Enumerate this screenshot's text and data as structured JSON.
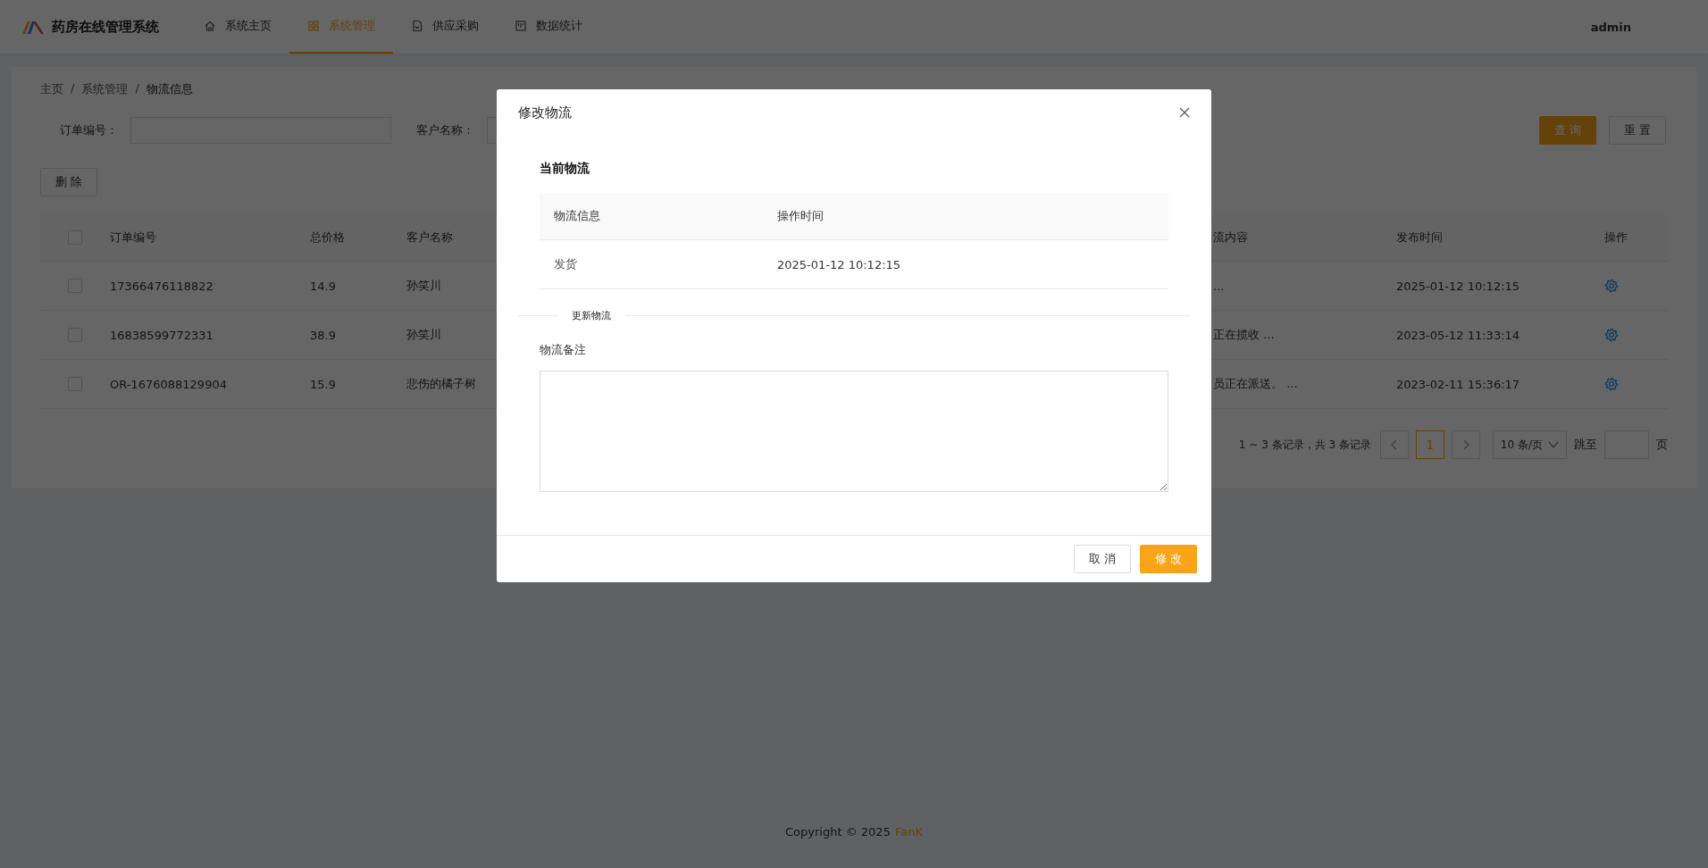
{
  "header": {
    "logo_text": "药房在线管理系统",
    "user": "admin",
    "nav": [
      {
        "label": "系统主页",
        "kind": "home",
        "selected": false
      },
      {
        "label": "系统管理",
        "kind": "grid",
        "selected": true
      },
      {
        "label": "供应采购",
        "kind": "doc",
        "selected": false
      },
      {
        "label": "数据统计",
        "kind": "board",
        "selected": false
      }
    ]
  },
  "breadcrumb": {
    "separator": "/",
    "items": [
      "主页",
      "系统管理",
      "物流信息"
    ]
  },
  "filters": [
    {
      "label": "订单编号："
    },
    {
      "label": "客户名称："
    }
  ],
  "filter_buttons": [
    {
      "label": "查 询",
      "primary": true
    },
    {
      "label": "重 置",
      "primary": false
    }
  ],
  "delete_button": "删 除",
  "table": {
    "all_checked": false,
    "columns": [
      "订单编号",
      "总价格",
      "客户名称",
      "流内容",
      "发布时间",
      "操作"
    ],
    "rows": [
      {
        "checked": false,
        "cells": [
          "17366476118822",
          "14.9",
          "孙笑川",
          "...",
          "2025-01-12 10:12:15"
        ]
      },
      {
        "checked": false,
        "cells": [
          "16838599772331",
          "38.9",
          "孙笑川",
          "正在揽收 ...",
          "2023-05-12 11:33:14"
        ]
      },
      {
        "checked": false,
        "cells": [
          "OR-1676088129904",
          "15.9",
          "悲伤的橘子树",
          "员正在派送。 ...",
          "2023-02-11 15:36:17"
        ]
      }
    ]
  },
  "pagination": {
    "summary": "1 ~ 3 条记录，共 3 条记录",
    "pages": [
      {
        "label": "1",
        "selected": true
      }
    ],
    "page_size": "10 条/页",
    "goto_label": "跳至",
    "page_suffix": "页"
  },
  "footer": {
    "text": "Copyright © 2025",
    "author": "FanK"
  },
  "modal": {
    "title": "修改物流",
    "section_title": "当前物流",
    "columns": [
      "物流信息",
      "操作时间"
    ],
    "rows": [
      [
        "发货",
        "2025-01-12 10:12:15"
      ]
    ],
    "divider_label": "更新物流",
    "field_label": "物流备注",
    "buttons": [
      {
        "label": "取 消",
        "primary": false
      },
      {
        "label": "修 改",
        "primary": true
      }
    ]
  }
}
